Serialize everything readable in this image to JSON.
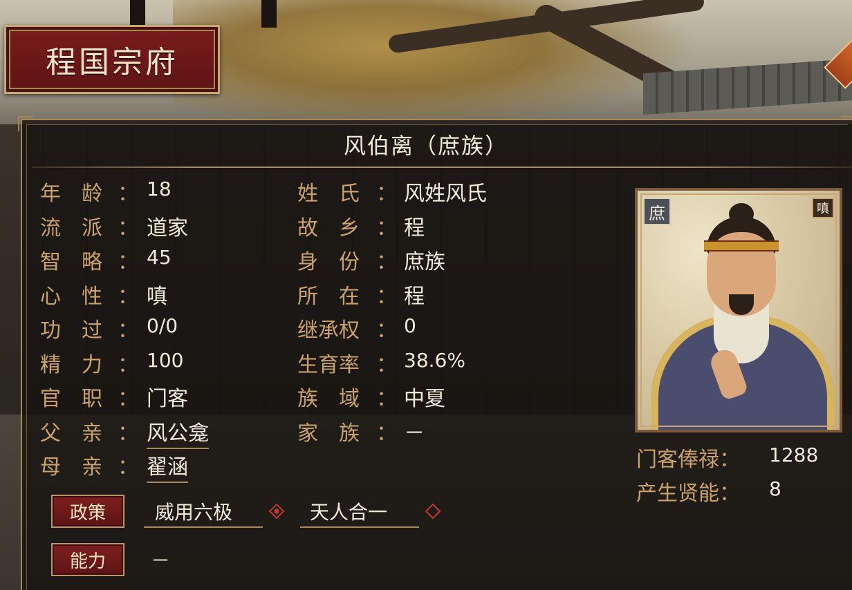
{
  "title": "程国宗府",
  "character": {
    "name": "风伯离（庶族）"
  },
  "left_attrs": [
    {
      "label": "年　龄",
      "value": "18"
    },
    {
      "label": "流　派",
      "value": "道家"
    },
    {
      "label": "智　略",
      "value": "45"
    },
    {
      "label": "心　性",
      "value": "嗔"
    },
    {
      "label": "功　过",
      "value": "0/0"
    },
    {
      "label": "精　力",
      "value": "100"
    },
    {
      "label": "官　职",
      "value": "门客"
    },
    {
      "label": "父　亲",
      "value": "风公龛"
    },
    {
      "label": "母　亲",
      "value": "翟涵"
    }
  ],
  "right_attrs": [
    {
      "label": "姓　氏",
      "value": "风姓风氏"
    },
    {
      "label": "故　乡",
      "value": "程"
    },
    {
      "label": "身　份",
      "value": "庶族"
    },
    {
      "label": "所　在",
      "value": "程"
    },
    {
      "label": "继承权",
      "value": "0"
    },
    {
      "label": "生育率",
      "value": "38.6%"
    },
    {
      "label": "族　域",
      "value": "中夏"
    },
    {
      "label": "家　族",
      "value": "－"
    }
  ],
  "colon": "：",
  "portrait": {
    "class_badge": "庶",
    "temper_badge": "嗔"
  },
  "retainer": {
    "salary_label": "门客俸禄：",
    "salary_value": "1288",
    "talent_label": "产生贤能：",
    "talent_value": "8"
  },
  "policy": {
    "button_label": "政策",
    "items": [
      {
        "name": "威用六极",
        "active": true
      },
      {
        "name": "天人合一",
        "active": false
      }
    ]
  },
  "ability": {
    "button_label": "能力",
    "value": "－"
  }
}
